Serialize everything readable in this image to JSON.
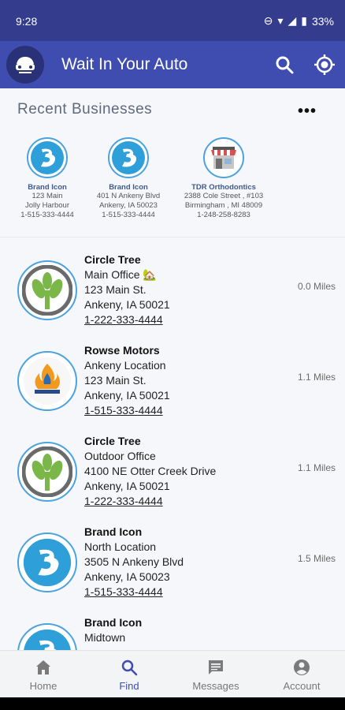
{
  "status_bar": {
    "time": "9:28",
    "battery": "33%"
  },
  "app": {
    "title": "Wait In Your Auto"
  },
  "recent": {
    "title": "Recent Businesses",
    "items": [
      {
        "name": "Brand Icon",
        "line1": "123 Main",
        "line2": "Jolly Harbour",
        "phone": "1-515-333-4444",
        "icon": "brand-icon-logo"
      },
      {
        "name": "Brand Icon",
        "line1": "401 N Ankeny Blvd",
        "line2": "Ankeny, IA 50023",
        "phone": "1-515-333-4444",
        "icon": "brand-icon-logo"
      },
      {
        "name": "TDR Orthodontics",
        "line1": "2388 Cole Street , #103",
        "line2": "Birmingham , MI 48009",
        "phone": "1-248-258-8283",
        "icon": "storefront-icon"
      }
    ]
  },
  "businesses": [
    {
      "name": "Circle Tree",
      "location": "Main Office 🏡",
      "address": "123 Main St.",
      "city": "Ankeny, IA 50021",
      "phone": "1-222-333-4444",
      "distance": "0.0 Miles",
      "icon": "tree-logo"
    },
    {
      "name": "Rowse Motors",
      "location": "Ankeny Location",
      "address": "123 Main St.",
      "city": "Ankeny, IA 50021",
      "phone": "1-515-333-4444",
      "distance": "1.1 Miles",
      "icon": "flame-logo"
    },
    {
      "name": "Circle Tree",
      "location": "Outdoor Office",
      "address": "4100 NE Otter Creek Drive",
      "city": "Ankeny, IA 50021",
      "phone": "1-222-333-4444",
      "distance": "1.1 Miles",
      "icon": "tree-logo"
    },
    {
      "name": "Brand Icon",
      "location": "North Location",
      "address": "3505 N Ankeny Blvd",
      "city": "Ankeny, IA 50023",
      "phone": "1-515-333-4444",
      "distance": "1.5 Miles",
      "icon": "brand-icon-logo"
    },
    {
      "name": "Brand Icon",
      "location": "Midtown",
      "address": "",
      "city": "",
      "phone": "",
      "distance": "",
      "icon": "brand-icon-logo"
    }
  ],
  "nav": [
    {
      "label": "Home",
      "icon": "home-icon",
      "active": false
    },
    {
      "label": "Find",
      "icon": "search-icon",
      "active": true
    },
    {
      "label": "Messages",
      "icon": "message-icon",
      "active": false
    },
    {
      "label": "Account",
      "icon": "account-icon",
      "active": false
    }
  ],
  "colors": {
    "status_bar": "#343c8e",
    "app_bar": "#3f4db1",
    "accent": "#4aa3df",
    "active_nav": "#3f4db1"
  }
}
